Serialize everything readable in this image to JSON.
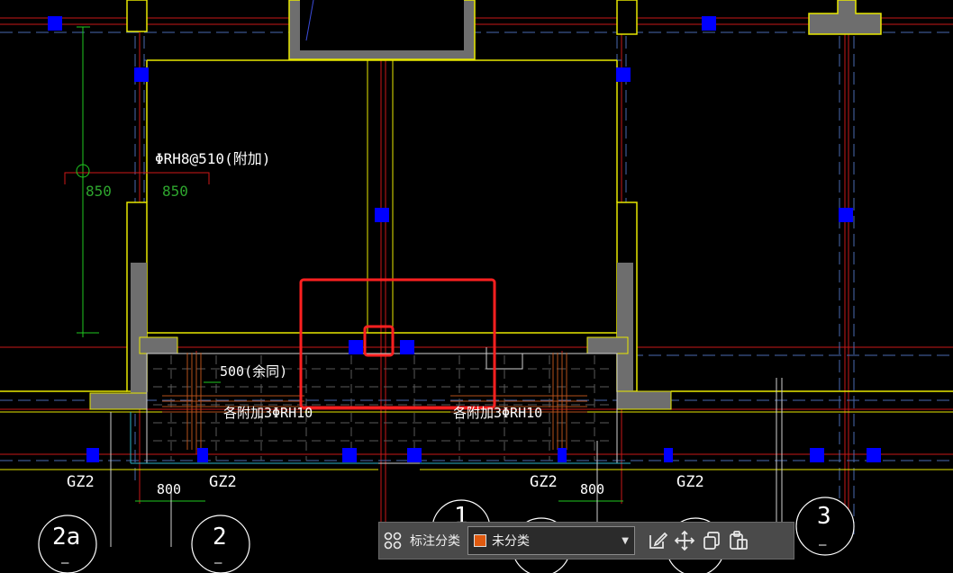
{
  "drawing": {
    "rebar_note": "ΦRH8@510(附加)",
    "dim_850_a": "850",
    "dim_850_b": "850",
    "dim_500": "500(余同)",
    "rebar_left": "各附加3ΦRH10",
    "rebar_right": "各附加3ΦRH10",
    "gz_labels": [
      "GZ2",
      "GZ2",
      "GZ2",
      "GZ2"
    ],
    "dim_800_a": "800",
    "dim_800_b": "800",
    "axis_labels": [
      "2a",
      "2",
      "1",
      "3"
    ],
    "axis_subs": [
      "—",
      "—",
      "—",
      "—"
    ]
  },
  "toolbar": {
    "category_label": "标注分类",
    "selected_category": "未分类",
    "selected_color": "#e05a10"
  },
  "colors": {
    "selection_box": "#ff2020",
    "marker": "#0000ff",
    "wall_line": "#e8e800",
    "axis_line": "#d01818"
  }
}
